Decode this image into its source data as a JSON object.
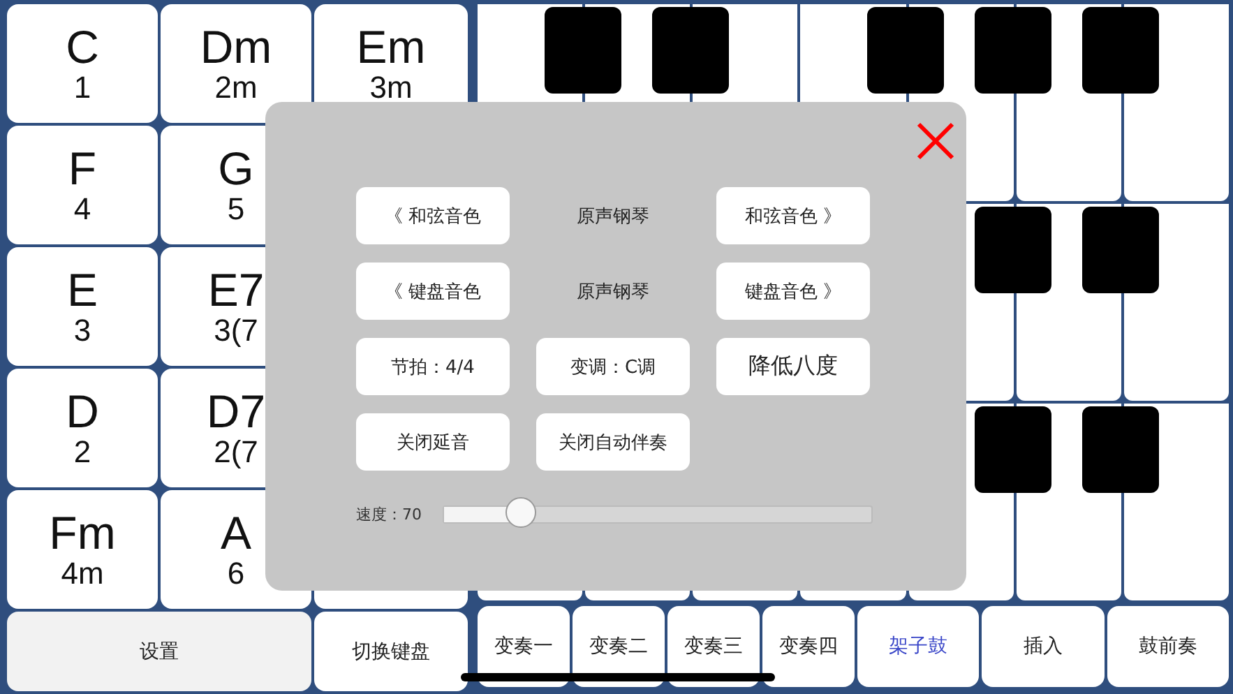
{
  "chord_rows": [
    [
      {
        "name": "C",
        "number": "1"
      },
      {
        "name": "Dm",
        "number": "2m"
      },
      {
        "name": "Em",
        "number": "3m"
      }
    ],
    [
      {
        "name": "F",
        "number": "4"
      },
      {
        "name": "G",
        "number": "5"
      }
    ],
    [
      {
        "name": "E",
        "number": "3"
      },
      {
        "name": "E7",
        "number": "3(7"
      }
    ],
    [
      {
        "name": "D",
        "number": "2"
      },
      {
        "name": "D7",
        "number": "2(7"
      }
    ],
    [
      {
        "name": "Fm",
        "number": "4m"
      },
      {
        "name": "A",
        "number": "6"
      }
    ]
  ],
  "settings_button": "设置",
  "switch_keyboard_button": "切换键盘",
  "variation_buttons": [
    "变奏一",
    "变奏二",
    "变奏三",
    "变奏四"
  ],
  "drum_buttons": [
    {
      "label": "架子鼓",
      "selected": true
    },
    {
      "label": "插入",
      "selected": false
    },
    {
      "label": "鼓前奏",
      "selected": false
    }
  ],
  "settings_dialog": {
    "rows": [
      [
        {
          "kind": "button",
          "label": "《 和弦音色"
        },
        {
          "kind": "label",
          "label": "原声钢琴"
        },
        {
          "kind": "button",
          "label": "和弦音色 》"
        }
      ],
      [
        {
          "kind": "button",
          "label": "《 键盘音色"
        },
        {
          "kind": "label",
          "label": "原声钢琴"
        },
        {
          "kind": "button",
          "label": "键盘音色 》"
        }
      ],
      [
        {
          "kind": "button",
          "label": "节拍：4/4"
        },
        {
          "kind": "button",
          "label": "变调：C调"
        },
        {
          "kind": "large-button",
          "label": "降低八度"
        }
      ],
      [
        {
          "kind": "button",
          "label": "关闭延音"
        },
        {
          "kind": "button",
          "label": "关闭自动伴奏"
        }
      ]
    ],
    "speed": {
      "label": "速度：70",
      "level": 0.18
    }
  }
}
